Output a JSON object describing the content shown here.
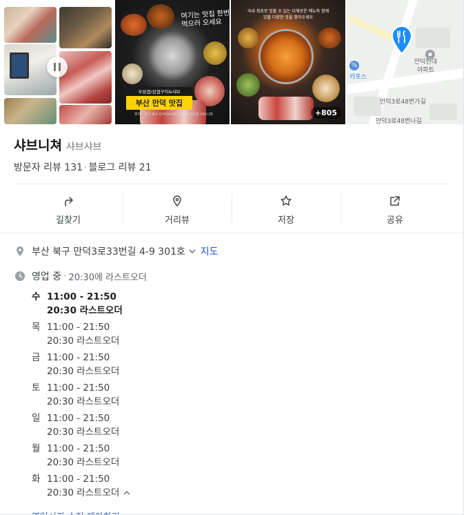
{
  "photos": {
    "panel1_text": "부산 만덕 맛집",
    "panel1_sub": "우삼겹/삼겹구이&샤브",
    "panel1_hand": "여기는 맛집 한번\n먹으러 오세요",
    "panel1_fine": "위치 : 부산 북구 만덕3로33번길 4-9 301호 샤브니쳐",
    "panel2_text": "국내 최초로 맛볼 수 있는 다채로운 메뉴와 함께\n맛볼 다양한 맛을 찾아오세요",
    "more_count": "+805"
  },
  "map": {
    "apt_label": "만덕현대\n아파트",
    "road1": "만덕3로48번가길",
    "road2": "만덕3로48번나길",
    "poi_partial": "카포스"
  },
  "place": {
    "name": "샤브니쳐",
    "category": "샤브샤브",
    "visitor_reviews": "방문자 리뷰 131",
    "blog_reviews": "블로그 리뷰 21"
  },
  "actions": [
    {
      "label": "길찾기",
      "icon": "directions-icon"
    },
    {
      "label": "거리뷰",
      "icon": "street-view-icon"
    },
    {
      "label": "저장",
      "icon": "star-icon"
    },
    {
      "label": "공유",
      "icon": "share-icon"
    }
  ],
  "address": {
    "text": "부산 북구 만덕3로33번길 4-9 301호",
    "map_link": "지도"
  },
  "hours": {
    "status": "영업 중",
    "note": "20:30에 라스트오더",
    "days": [
      {
        "day": "수",
        "time": "11:00 - 21:50",
        "last": "20:30 라스트오더",
        "today": true
      },
      {
        "day": "목",
        "time": "11:00 - 21:50",
        "last": "20:30 라스트오더"
      },
      {
        "day": "금",
        "time": "11:00 - 21:50",
        "last": "20:30 라스트오더"
      },
      {
        "day": "토",
        "time": "11:00 - 21:50",
        "last": "20:30 라스트오더"
      },
      {
        "day": "일",
        "time": "11:00 - 21:50",
        "last": "20:30 라스트오더"
      },
      {
        "day": "월",
        "time": "11:00 - 21:50",
        "last": "20:30 라스트오더"
      },
      {
        "day": "화",
        "time": "11:00 - 21:50",
        "last": "20:30 라스트오더"
      }
    ],
    "suggest_edit": "영업시간 수정 제안하기"
  },
  "colors": {
    "link": "#1a56c9",
    "pin": "#1a8cff",
    "text": "#3c4043",
    "muted": "#70757a"
  }
}
